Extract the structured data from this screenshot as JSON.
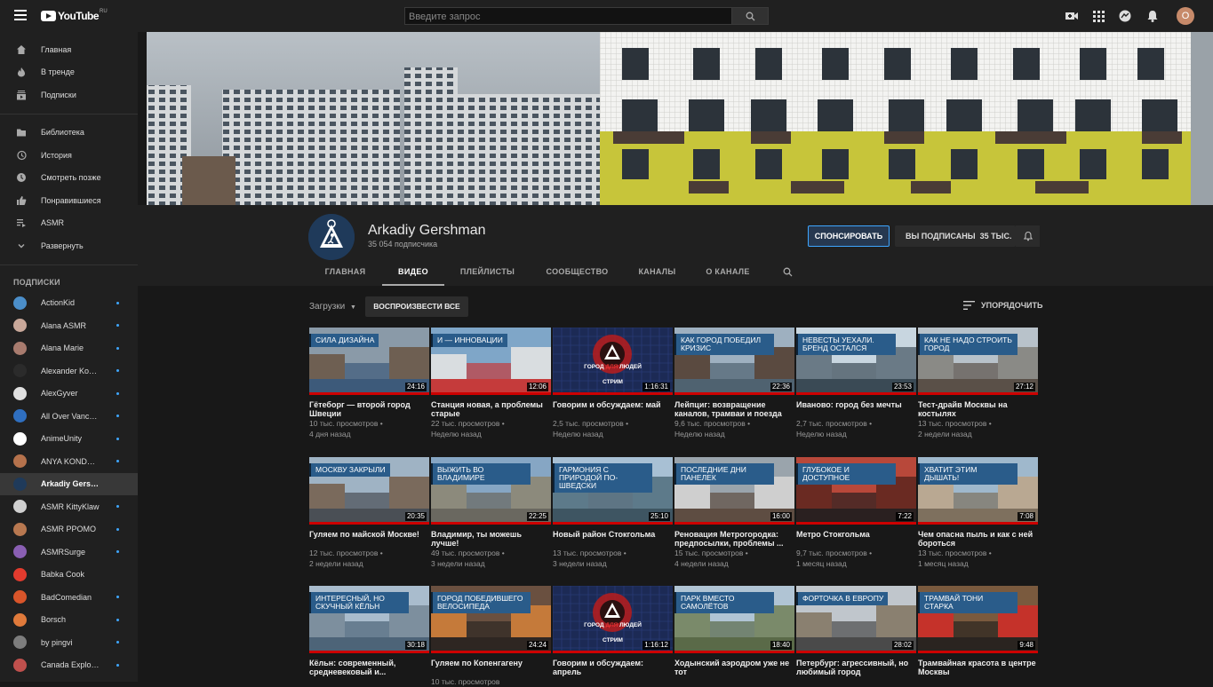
{
  "header": {
    "logo_text": "YouTube",
    "logo_region": "RU",
    "search_placeholder": "Введите запрос",
    "avatar_letter": "O"
  },
  "sidebar": {
    "main": [
      {
        "label": "Главная",
        "icon": "home-icon"
      },
      {
        "label": "В тренде",
        "icon": "flame-icon"
      },
      {
        "label": "Подписки",
        "icon": "subscriptions-icon"
      }
    ],
    "library": [
      {
        "label": "Библиотека",
        "icon": "folder-icon"
      },
      {
        "label": "История",
        "icon": "history-icon"
      },
      {
        "label": "Смотреть позже",
        "icon": "clock-icon"
      },
      {
        "label": "Понравившиеся",
        "icon": "thumb-up-icon"
      },
      {
        "label": "ASMR",
        "icon": "playlist-icon"
      },
      {
        "label": "Развернуть",
        "icon": "chevron-down-icon"
      }
    ],
    "subscriptions_heading": "ПОДПИСКИ",
    "subscriptions": [
      {
        "name": "ActionKid",
        "color": "#4b8ec9",
        "dot": true
      },
      {
        "name": "Alana ASMR",
        "color": "#c9a89a",
        "dot": true
      },
      {
        "name": "Alana Marie",
        "color": "#a87b6e",
        "dot": true
      },
      {
        "name": "Alexander Kon...",
        "color": "#2b2b2b",
        "dot": true
      },
      {
        "name": "AlexGyver",
        "color": "#e0e0e0",
        "dot": true
      },
      {
        "name": "All Over Vanco...",
        "color": "#2f6fc0",
        "dot": true
      },
      {
        "name": "AnimeUnity",
        "color": "#ffffff",
        "dot": true
      },
      {
        "name": "ANYA KONDRA...",
        "color": "#b5724c",
        "dot": true
      },
      {
        "name": "Arkadiy Gershman",
        "color": "#1f3a5a",
        "dot": false
      },
      {
        "name": "ASMR KittyKlaw",
        "color": "#d0d0d0",
        "dot": true
      },
      {
        "name": "ASMR PPOMO",
        "color": "#b87850",
        "dot": true
      },
      {
        "name": "ASMRSurge",
        "color": "#8a5fb3",
        "dot": true
      },
      {
        "name": "Babka Cook",
        "color": "#e33b2e",
        "dot": false
      },
      {
        "name": "BadComedian",
        "color": "#d9552a",
        "dot": true
      },
      {
        "name": "Borsch",
        "color": "#e07a3b",
        "dot": true
      },
      {
        "name": "by pingvi",
        "color": "#7d7d7d",
        "dot": true
      },
      {
        "name": "Canada Explorer",
        "color": "#c0504d",
        "dot": true
      }
    ]
  },
  "channel": {
    "name": "Arkadiy Gershman",
    "subscribers": "35 054 подписчика",
    "sponsor_label": "СПОНСИРОВАТЬ",
    "subscribed_label": "ВЫ ПОДПИСАНЫ",
    "subscribed_count": "35 ТЫС.",
    "tabs": [
      "ГЛАВНАЯ",
      "ВИДЕО",
      "ПЛЕЙЛИСТЫ",
      "СООБЩЕСТВО",
      "КАНАЛЫ",
      "О КАНАЛЕ"
    ],
    "active_tab": "ВИДЕО"
  },
  "uploads": {
    "label": "Загрузки",
    "play_all": "ВОСПРОИЗВЕСТИ ВСЕ",
    "sort": "УПОРЯДОЧИТЬ"
  },
  "videos": [
    {
      "caption": "СИЛА ДИЗАЙНА",
      "duration": "24:16",
      "title": "Гётеборг — второй город Швеции",
      "views": "10 тыс. просмотров",
      "age": "4 дня назад",
      "scene": "city",
      "stream": false
    },
    {
      "caption": "И — ИННОВАЦИИ",
      "duration": "12:06",
      "title": "Станция новая, а проблемы старые",
      "views": "22 тыс. просмотров",
      "age": "Неделю назад",
      "scene": "train",
      "stream": false
    },
    {
      "caption": "",
      "duration": "1:16:31",
      "title": "Говорим и обсуждаем: май",
      "views": "2,5 тыс. просмотров",
      "age": "Неделю назад",
      "scene": "stream",
      "stream": true
    },
    {
      "caption": "КАК ГОРОД ПОБЕДИЛ КРИЗИС",
      "duration": "22:36",
      "title": "Лейпциг: возвращение каналов, трамваи и поезда",
      "views": "9,6 тыс. просмотров",
      "age": "Неделю назад",
      "scene": "canal",
      "stream": false
    },
    {
      "caption": "НЕВЕСТЫ УЕХАЛИ. БРЕНД ОСТАЛСЯ",
      "duration": "23:53",
      "title": "Иваново: город без мечты",
      "views": "2,7 тыс. просмотров",
      "age": "Неделю назад",
      "scene": "parking",
      "stream": false
    },
    {
      "caption": "КАК НЕ НАДО СТРОИТЬ ГОРОД",
      "duration": "27:12",
      "title": "Тест-драйв Москвы на костылях",
      "views": "13 тыс. просмотров",
      "age": "2 недели назад",
      "scene": "stairs",
      "stream": false
    },
    {
      "caption": "МОСКВУ ЗАКРЫЛИ",
      "duration": "20:35",
      "title": "Гуляем по майской Москве!",
      "views": "12 тыс. просмотров",
      "age": "2 недели назад",
      "scene": "street",
      "stream": false
    },
    {
      "caption": "ВЫЖИТЬ ВО ВЛАДИМИРЕ",
      "duration": "22:25",
      "title": "Владимир, ты можешь лучше!",
      "views": "49 тыс. просмотров",
      "age": "3 недели назад",
      "scene": "road",
      "stream": false
    },
    {
      "caption": "ГАРМОНИЯ С ПРИРОДОЙ ПО-ШВЕДСКИ",
      "duration": "25:10",
      "title": "Новый район Стокгольма",
      "views": "13 тыс. просмотров",
      "age": "3 недели назад",
      "scene": "lake",
      "stream": false
    },
    {
      "caption": "ПОСЛЕДНИЕ ДНИ ПАНЕЛЕК",
      "duration": "16:00",
      "title": "Реновация Метрогородка: предпосылки, проблемы ...",
      "views": "15 тыс. просмотров",
      "age": "4 недели назад",
      "scene": "panel",
      "stream": false
    },
    {
      "caption": "ГЛУБОКОЕ И ДОСТУПНОЕ",
      "duration": "7:22",
      "title": "Метро Стокгольма",
      "views": "9,7 тыс. просмотров",
      "age": "1 месяц назад",
      "scene": "metro",
      "stream": false
    },
    {
      "caption": "ХВАТИТ ЭТИМ ДЫШАТЬ!",
      "duration": "7:08",
      "title": "Чем опасна пыль и как с ней бороться",
      "views": "13 тыс. просмотров",
      "age": "1 месяц назад",
      "scene": "dust",
      "stream": false
    },
    {
      "caption": "ИНТЕРЕСНЫЙ, НО СКУЧНЫЙ КЁЛЬН",
      "duration": "30:18",
      "title": "Кёльн: современный, средневековый и...",
      "views": "",
      "age": "",
      "scene": "river",
      "stream": false
    },
    {
      "caption": "ГОРОД ПОБЕДИВШЕГО ВЕЛОСИПЕДА",
      "duration": "24:24",
      "title": "Гуляем по Копенгагену",
      "views": "10 тыс. просмотров",
      "age": "",
      "scene": "bike",
      "stream": false
    },
    {
      "caption": "",
      "duration": "1:16:12",
      "title": "Говорим и обсуждаем: апрель",
      "views": "",
      "age": "",
      "scene": "stream",
      "stream": true
    },
    {
      "caption": "ПАРК ВМЕСТО САМОЛЁТОВ",
      "duration": "18:40",
      "title": "Ходынский аэродром уже не тот",
      "views": "",
      "age": "",
      "scene": "park",
      "stream": false
    },
    {
      "caption": "ФОРТОЧКА В ЕВРОПУ",
      "duration": "28:02",
      "title": "Петербург: агрессивный, но любимый город",
      "views": "",
      "age": "",
      "scene": "peter",
      "stream": false
    },
    {
      "caption": "ТРАМВАЙ ТОНИ СТАРКА",
      "duration": "9:48",
      "title": "Трамвайная красота в центре Москвы",
      "views": "",
      "age": "",
      "scene": "tram",
      "stream": false
    }
  ],
  "stream_overlay": {
    "line1": "ГОРОД",
    "line2": "ДЛЯ",
    "line3": "ЛЮДЕЙ",
    "stream": "СТРИМ"
  }
}
